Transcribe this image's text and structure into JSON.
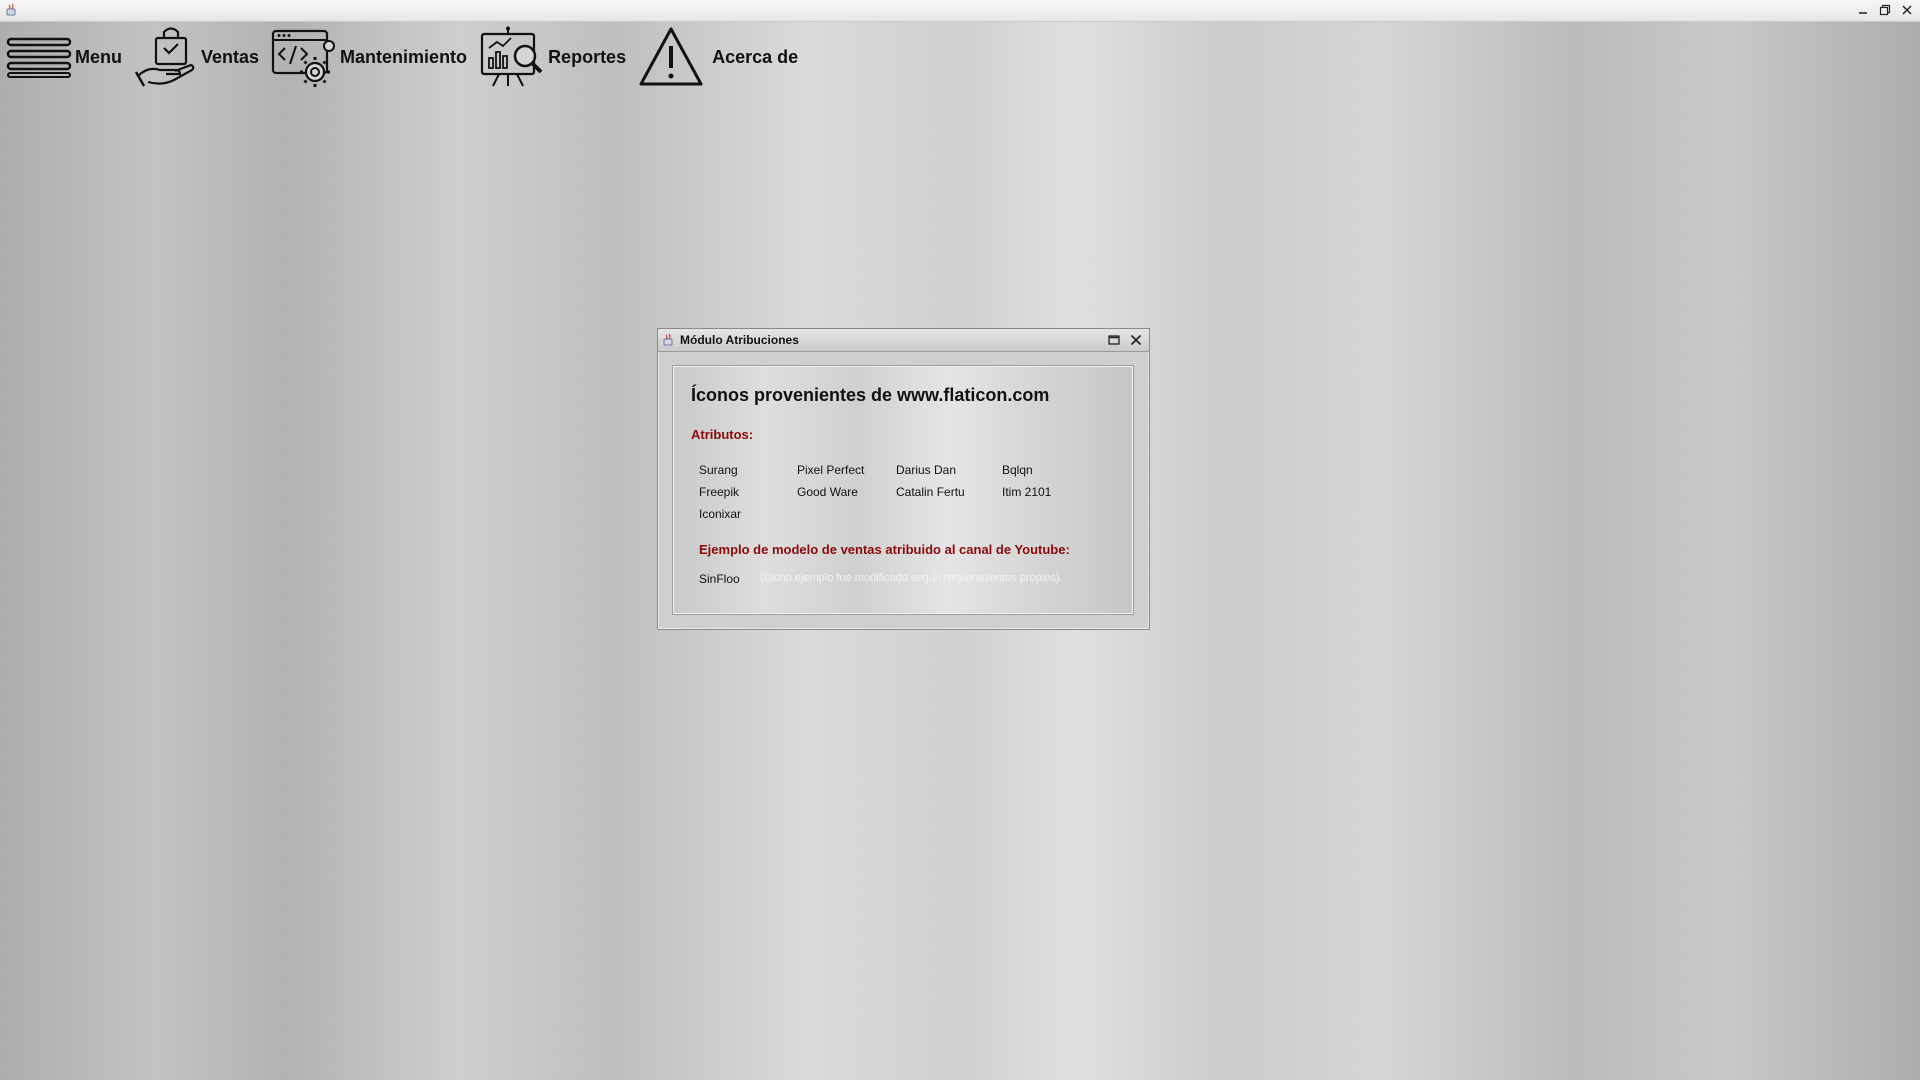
{
  "window": {
    "controls": {
      "minimize_icon": "minimize-icon",
      "restore_icon": "restore-icon",
      "close_icon": "close-icon"
    }
  },
  "menubar": {
    "items": [
      {
        "label": "Menu",
        "icon": "hamburger-icon"
      },
      {
        "label": "Ventas",
        "icon": "shopping-bag-hand-icon"
      },
      {
        "label": "Mantenimiento",
        "icon": "code-settings-icon"
      },
      {
        "label": "Reportes",
        "icon": "report-chart-icon"
      },
      {
        "label": "Acerca de",
        "icon": "warning-triangle-icon"
      }
    ]
  },
  "dialog": {
    "title": "Módulo Atribuciones",
    "heading": "Íconos provenientes de www.flaticon.com",
    "attributes_label": "Atributos:",
    "authors": [
      [
        "Surang",
        "Pixel Perfect",
        "Darius Dan",
        "Bqlqn"
      ],
      [
        "Freepik",
        "Good Ware",
        "Catalin Fertu",
        "Itim 2101"
      ],
      [
        "Iconixar"
      ]
    ],
    "youtube_label": "Ejemplo de modelo de ventas atribuido al canal de Youtube:",
    "youtube_author": "SinFloo",
    "note": "(Dicho ejemplo fue modificado segun requerimientos propios)."
  }
}
